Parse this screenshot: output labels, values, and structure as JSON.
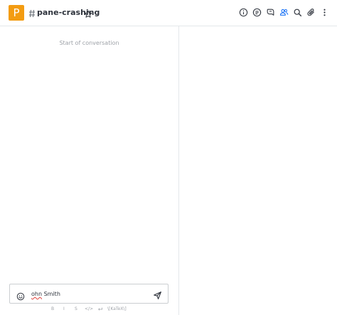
{
  "header": {
    "avatar_letter": "P",
    "avatar_color": "#f39c12",
    "room_name": "pane-crashing",
    "icons": [
      "info-icon",
      "threads-icon",
      "discussions-icon",
      "members-icon",
      "search-icon",
      "attachment-icon",
      "kebab-menu-icon"
    ],
    "members_icon_color": "#1d74f5"
  },
  "chat": {
    "start_label": "Start of conversation"
  },
  "composer": {
    "misspelled_part": "ohn",
    "rest_text": " Smith"
  },
  "toolbar": {
    "bold": "B",
    "italic": "I",
    "strike": "S",
    "code": "</>",
    "katex": "\\[KaTeX\\]"
  }
}
